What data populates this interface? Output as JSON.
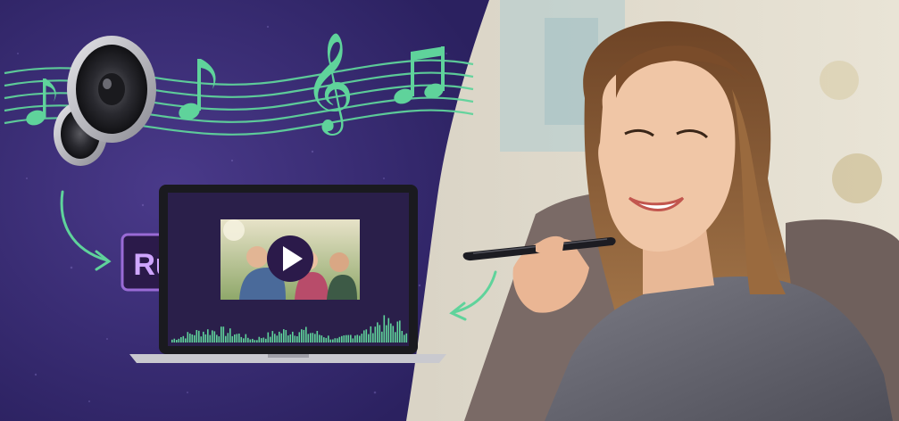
{
  "app_badge": {
    "label": "Ru"
  },
  "colors": {
    "panel_bg": "#2f2563",
    "panel_bg_light": "#4a3a8a",
    "accent_green": "#5fd39b",
    "badge_bg": "#2b1a4a",
    "badge_border": "#9a6bd6",
    "badge_text": "#cfa6ff",
    "laptop_frame": "#1a1a1f",
    "laptop_screen": "#2a1f4a",
    "laptop_base": "#c9c9cf",
    "play_button": "#2b1a4a",
    "photo_bg": "#c8dbe6",
    "shirt": "#6a6a74",
    "hair": "#8a5a34",
    "skin": "#f0c6a6",
    "couch": "#7a6a66"
  },
  "icons": [
    "speaker-icon",
    "music-note-icon",
    "treble-clef-icon",
    "beamed-notes-icon",
    "play-icon",
    "arrow-icon"
  ]
}
